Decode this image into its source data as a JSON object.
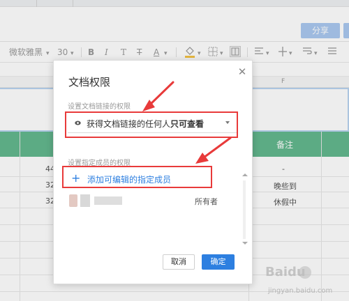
{
  "header": {
    "share_label": "分享"
  },
  "toolbar": {
    "font_name": "微软雅黑",
    "font_size": "30",
    "bold": "B",
    "italic": "I",
    "text_style": "T",
    "strikethrough": "T",
    "font_color": "A"
  },
  "columns": {
    "f": "F"
  },
  "sheet": {
    "header_cell": "备注",
    "rows": [
      {
        "number": "44",
        "note": "-"
      },
      {
        "number": "32",
        "note": "晚些到"
      },
      {
        "number": "32",
        "note": "休假中"
      }
    ]
  },
  "dialog": {
    "title": "文档权限",
    "close_icon": "close-icon",
    "link_section_label": "设置文档链接的权限",
    "link_permission_prefix": "获得文档链接的任何人",
    "link_permission_emphasis": "只可查看",
    "member_section_label": "设置指定成员的权限",
    "add_member_label": "添加可编辑的指定成员",
    "member_role": "所有者",
    "cancel_label": "取消",
    "ok_label": "确定"
  },
  "colors": {
    "accent": "#2d7fe0",
    "header_green": "#63b88e",
    "annotation_red": "#e83a3a"
  },
  "watermark": {
    "brand": "Baidu",
    "subtitle": "jingyan.baidu.com"
  }
}
